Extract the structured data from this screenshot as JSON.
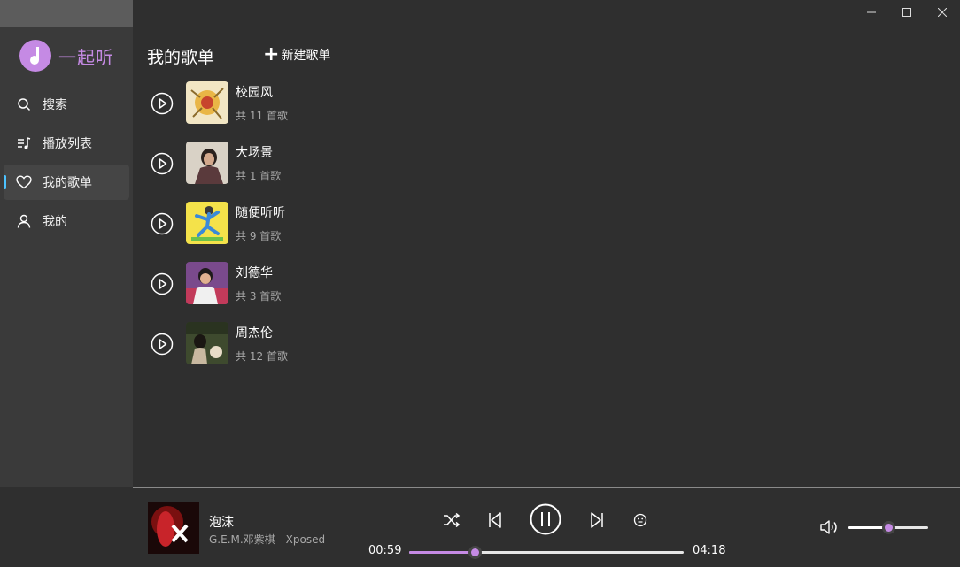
{
  "app": {
    "name": "一起听"
  },
  "window": {
    "minimize": "minimize",
    "maximize": "maximize",
    "close": "close"
  },
  "sidebar": {
    "items": [
      {
        "label": "搜索",
        "icon": "search-icon",
        "active": false
      },
      {
        "label": "播放列表",
        "icon": "queue-icon",
        "active": false
      },
      {
        "label": "我的歌单",
        "icon": "heart-icon",
        "active": true
      },
      {
        "label": "我的",
        "icon": "user-icon",
        "active": false
      }
    ]
  },
  "main": {
    "title": "我的歌单",
    "new_playlist_label": "新建歌单",
    "playlists": [
      {
        "name": "校园风",
        "count": "共 11 首歌"
      },
      {
        "name": "大场景",
        "count": "共 1 首歌"
      },
      {
        "name": "随便听听",
        "count": "共 9 首歌"
      },
      {
        "name": "刘德华",
        "count": "共 3 首歌"
      },
      {
        "name": "周杰伦",
        "count": "共 12 首歌"
      }
    ]
  },
  "player": {
    "title": "泡沫",
    "artist": "G.E.M.邓紫棋 - Xposed",
    "current_time": "00:59",
    "total_time": "04:18",
    "progress": 0.24,
    "volume": 0.5,
    "accent_color": "#c58ae4"
  }
}
